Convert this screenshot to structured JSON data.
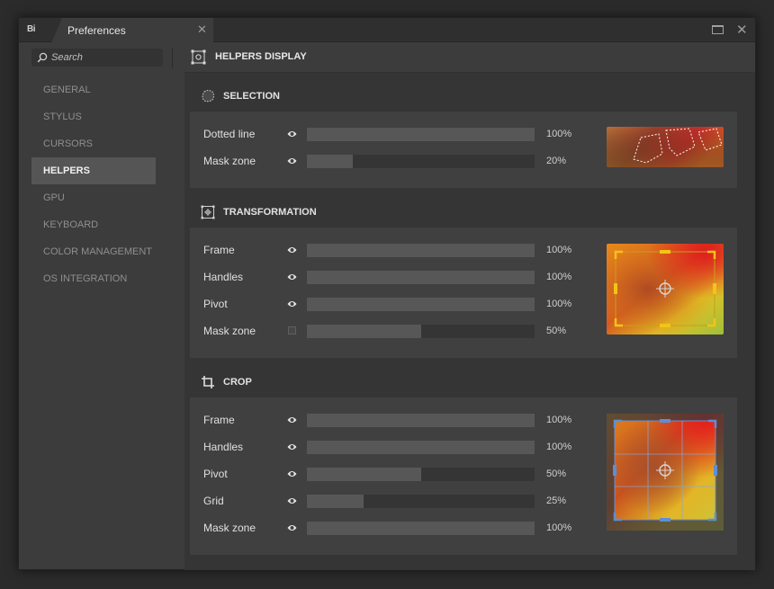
{
  "window": {
    "app_logo": "Bi",
    "tab_title": "Preferences"
  },
  "search": {
    "placeholder": "Search"
  },
  "nav": {
    "items": [
      {
        "label": "GENERAL"
      },
      {
        "label": "STYLUS"
      },
      {
        "label": "CURSORS"
      },
      {
        "label": "HELPERS",
        "active": true
      },
      {
        "label": "GPU"
      },
      {
        "label": "KEYBOARD"
      },
      {
        "label": "COLOR MANAGEMENT"
      },
      {
        "label": "OS INTEGRATION"
      }
    ]
  },
  "page": {
    "title": "HELPERS DISPLAY"
  },
  "sections": {
    "selection": {
      "title": "SELECTION",
      "rows": [
        {
          "label": "Dotted line",
          "value": 100,
          "display": "100%",
          "control": "eye"
        },
        {
          "label": "Mask zone",
          "value": 20,
          "display": "20%",
          "control": "eye"
        }
      ]
    },
    "transformation": {
      "title": "TRANSFORMATION",
      "rows": [
        {
          "label": "Frame",
          "value": 100,
          "display": "100%",
          "control": "eye"
        },
        {
          "label": "Handles",
          "value": 100,
          "display": "100%",
          "control": "eye"
        },
        {
          "label": "Pivot",
          "value": 100,
          "display": "100%",
          "control": "eye"
        },
        {
          "label": "Mask zone",
          "value": 50,
          "display": "50%",
          "control": "checkbox"
        }
      ]
    },
    "crop": {
      "title": "CROP",
      "rows": [
        {
          "label": "Frame",
          "value": 100,
          "display": "100%",
          "control": "eye"
        },
        {
          "label": "Handles",
          "value": 100,
          "display": "100%",
          "control": "eye"
        },
        {
          "label": "Pivot",
          "value": 50,
          "display": "50%",
          "control": "eye"
        },
        {
          "label": "Grid",
          "value": 25,
          "display": "25%",
          "control": "eye"
        },
        {
          "label": "Mask zone",
          "value": 100,
          "display": "100%",
          "control": "eye"
        }
      ]
    }
  },
  "colors": {
    "transform_frame": "#e8c21a",
    "crop_frame": "#5b8fd6",
    "window_bg": "#3c3c3c",
    "active_nav": "#555555"
  }
}
